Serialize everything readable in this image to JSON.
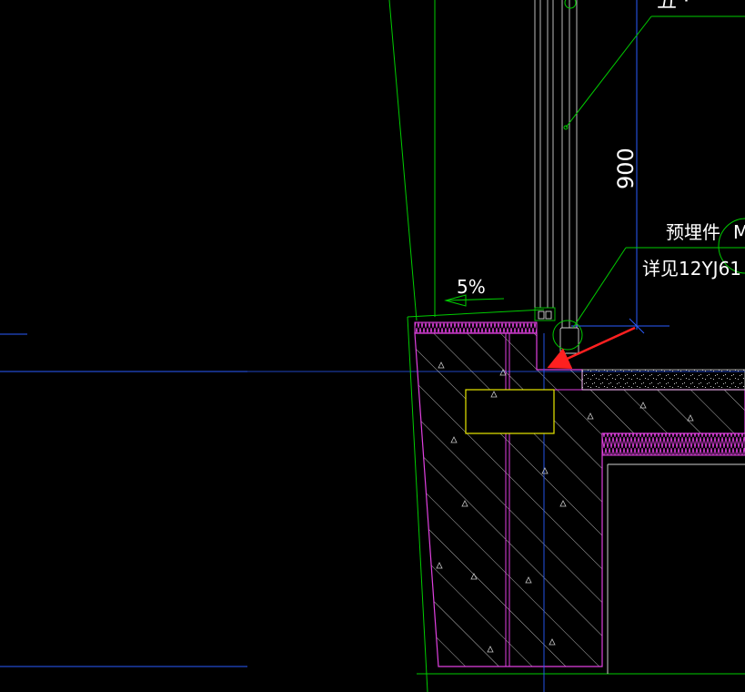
{
  "drawing": {
    "background": "#000000",
    "colors": {
      "outline_green": "#00cc00",
      "guide_blue": "#2a5cff",
      "wall_magenta": "#e040e0",
      "insulation_magenta": "#e040e0",
      "hatch_gray": "#c8c8c8",
      "window_white": "#d0d0d0",
      "embed_yellow": "#e8e800",
      "text_white": "#ffffff",
      "arrow_red": "#ff2020"
    },
    "labels": {
      "top_fragment": "五 ·",
      "dimension": "900",
      "slope": "5%",
      "embedded_part": "预埋件",
      "embedded_part_suffix": "M",
      "reference": "详见12YJ61"
    },
    "icons": {
      "callout_marker": "circle-callout-icon",
      "pointer": "red-arrow-icon"
    }
  }
}
